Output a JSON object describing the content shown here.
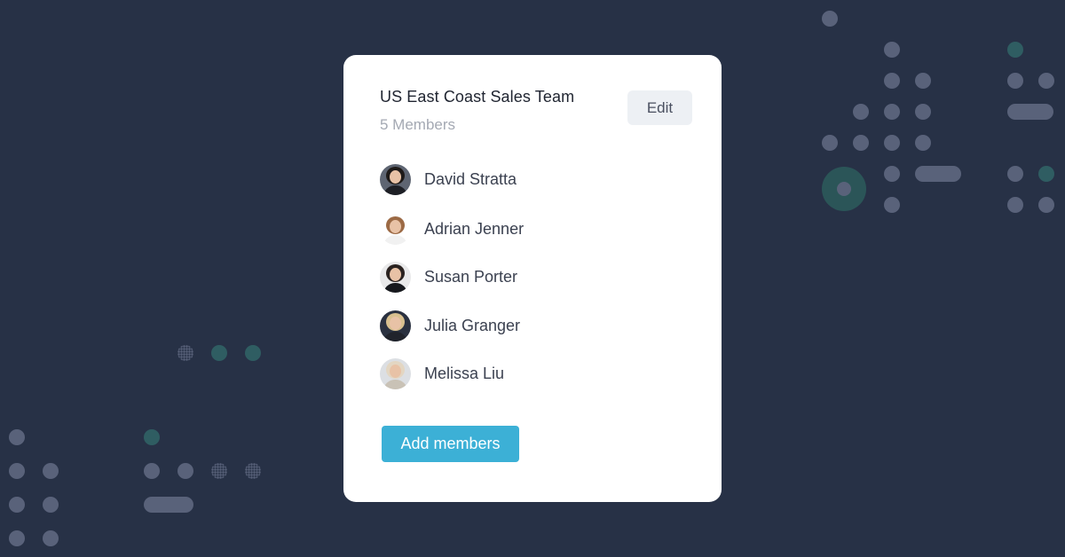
{
  "team": {
    "title": "US East Coast Sales Team",
    "member_count": "5 Members",
    "edit_label": "Edit",
    "add_label": "Add members"
  },
  "members": [
    {
      "name": "David Stratta"
    },
    {
      "name": "Adrian Jenner"
    },
    {
      "name": "Susan Porter"
    },
    {
      "name": "Julia Granger"
    },
    {
      "name": "Melissa Liu"
    }
  ],
  "colors": {
    "background": "#273146",
    "card": "#ffffff",
    "accent": "#3cb0d6",
    "decor_gray": "#59627a",
    "decor_teal": "#2f5d62"
  },
  "icons": [
    "avatar-photo-icon"
  ]
}
